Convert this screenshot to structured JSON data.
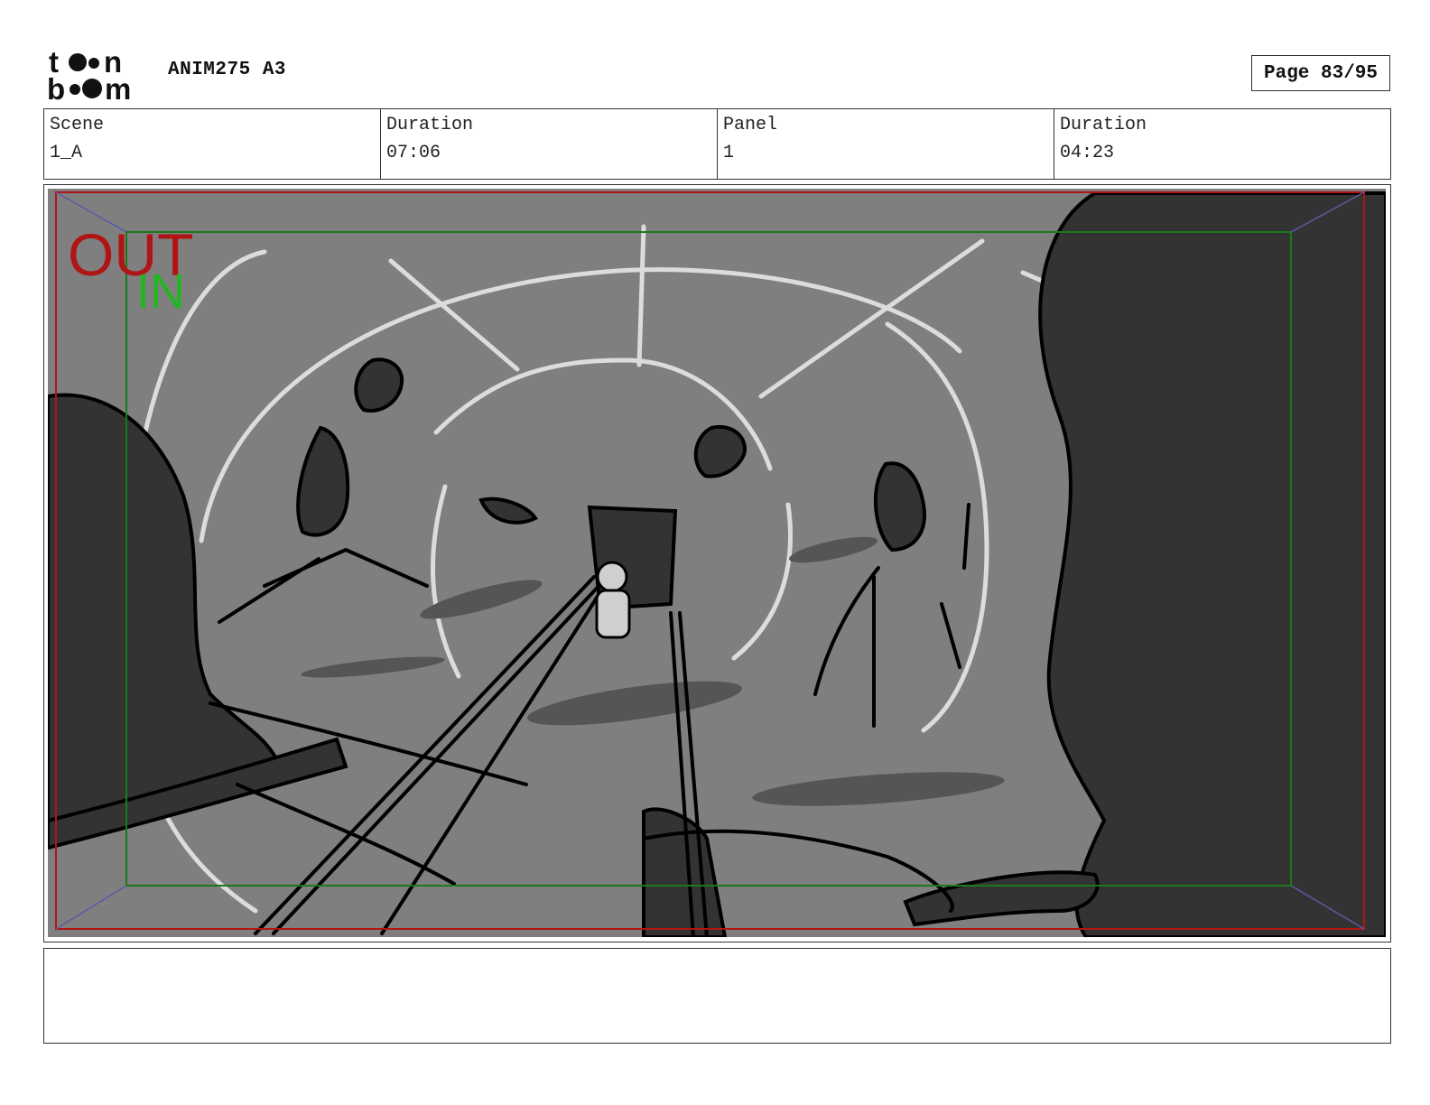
{
  "header": {
    "logo": {
      "line1": "toon",
      "line2": "boom"
    },
    "project_title": "ANIM275 A3",
    "page_label": "Page 83/95"
  },
  "info": {
    "scene_label": "Scene",
    "scene_value": "1_A",
    "scene_duration_label": "Duration",
    "scene_duration_value": "07:06",
    "panel_label": "Panel",
    "panel_value": "1",
    "panel_duration_label": "Duration",
    "panel_duration_value": "04:23"
  },
  "panel": {
    "out_label": "OUT",
    "in_label": "IN",
    "colors": {
      "background": "#7f7f7f",
      "dark_shape": "#333333",
      "web_line": "#dcdcdc",
      "out_frame": "#b01515",
      "in_frame": "#1a7a1a",
      "in_text": "#22b522",
      "corner_lines": "#5a5aa8"
    }
  },
  "notes": {
    "text": ""
  }
}
